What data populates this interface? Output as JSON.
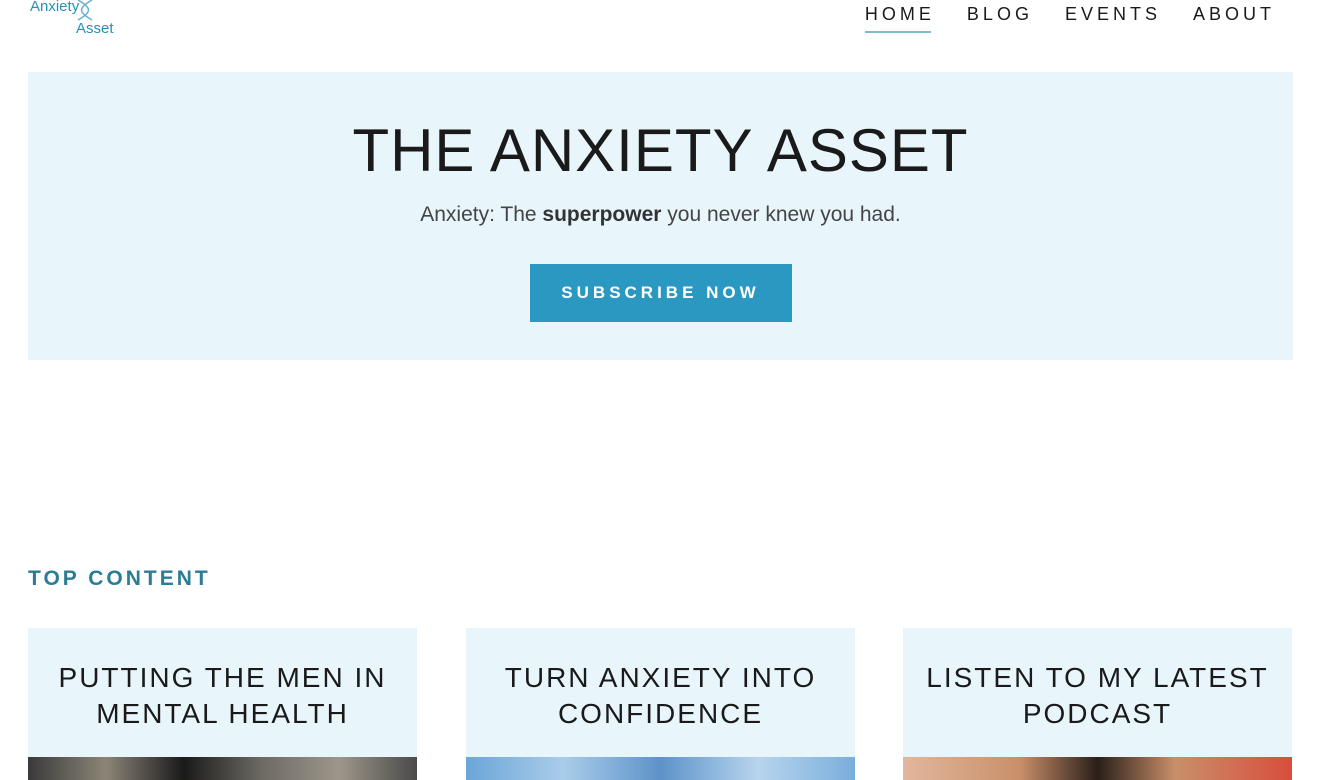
{
  "header": {
    "logo": {
      "line1": "Anxiety",
      "line2": "Asset"
    },
    "nav": [
      {
        "label": "HOME",
        "active": true
      },
      {
        "label": "BLOG",
        "active": false
      },
      {
        "label": "EVENTS",
        "active": false
      },
      {
        "label": "ABOUT",
        "active": false
      }
    ]
  },
  "hero": {
    "title": "THE ANXIETY ASSET",
    "subtitle_prefix": "Anxiety: The ",
    "subtitle_bold": "superpower",
    "subtitle_suffix": " you never knew you had.",
    "cta_label": "SUBSCRIBE NOW"
  },
  "top_content": {
    "heading": "TOP CONTENT",
    "cards": [
      {
        "title": "PUTTING THE MEN IN MENTAL HEALTH"
      },
      {
        "title": "TURN ANXIETY INTO CONFIDENCE"
      },
      {
        "title": "LISTEN TO MY LATEST PODCAST"
      }
    ]
  },
  "colors": {
    "accent": "#2a98c0",
    "hero_bg": "#e8f6fc",
    "section_heading": "#2b7c96"
  }
}
